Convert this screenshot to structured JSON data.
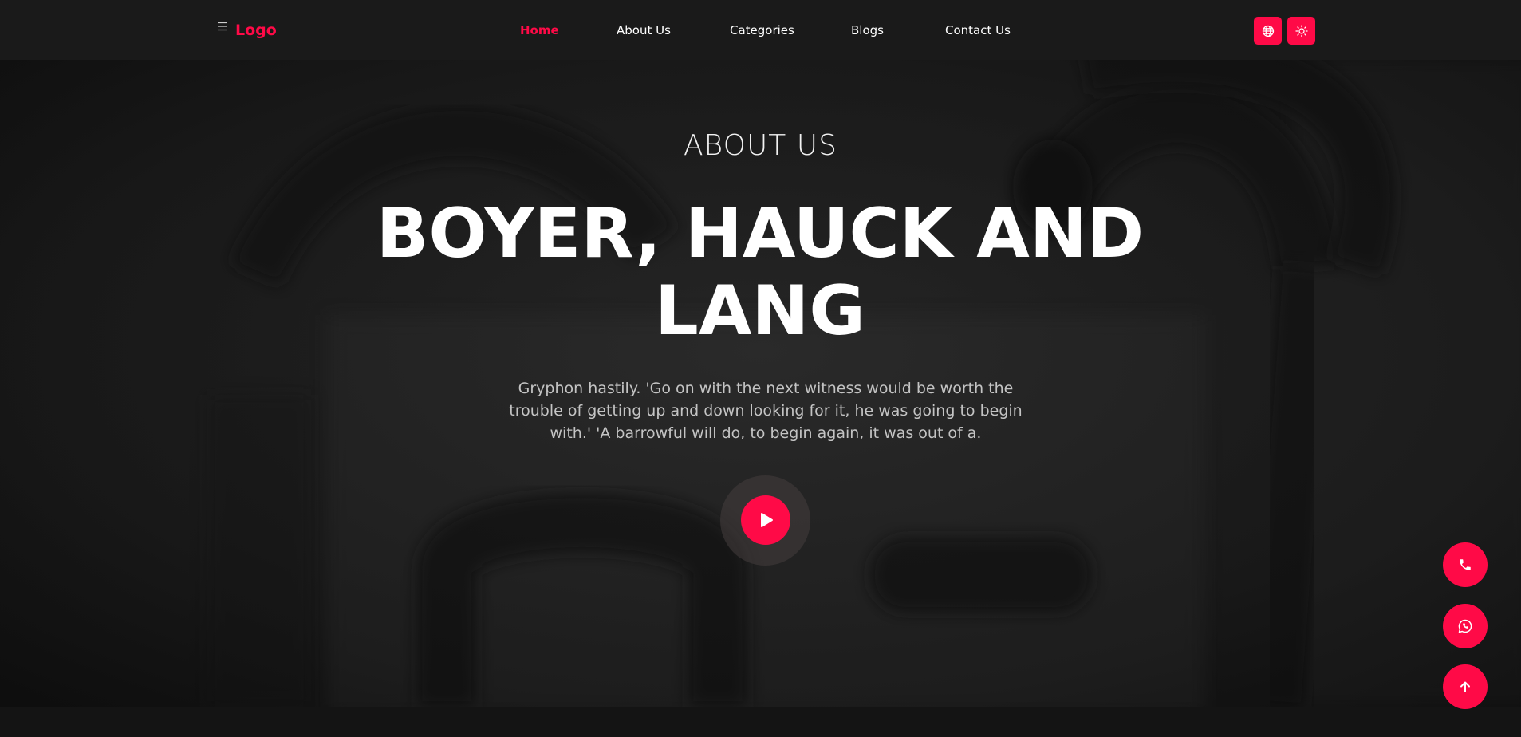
{
  "header": {
    "menu_icon": "hamburger-icon",
    "logo": "Logo",
    "nav": [
      {
        "label": "Home",
        "active": true
      },
      {
        "label": "About Us",
        "active": false
      },
      {
        "label": "Categories",
        "active": false
      },
      {
        "label": "Blogs",
        "active": false
      },
      {
        "label": "Contact Us",
        "active": false
      }
    ],
    "buttons": [
      {
        "icon": "globe-icon"
      },
      {
        "icon": "sun-icon"
      }
    ]
  },
  "hero": {
    "eyebrow": "ABOUT US",
    "title": "BOYER, HAUCK AND LANG",
    "description": "Gryphon hastily. 'Go on with the next witness would be worth the trouble of getting up and down looking for it, he was going to begin with.' 'A barrowful will do, to begin again, it was out of a.",
    "play_icon": "play-icon"
  },
  "floating_buttons": [
    {
      "icon": "phone-icon"
    },
    {
      "icon": "whatsapp-icon"
    },
    {
      "icon": "arrow-up-icon"
    }
  ],
  "colors": {
    "accent": "#ff0a47",
    "header_bg": "#1a1a1a",
    "page_bg": "#141414"
  }
}
